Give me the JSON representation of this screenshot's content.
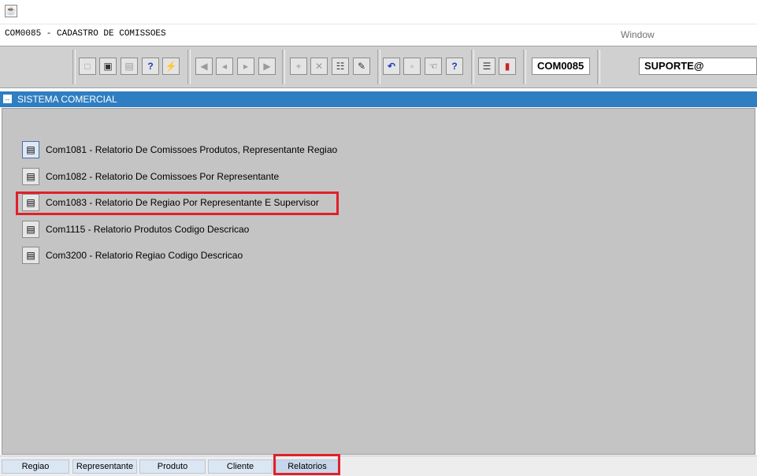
{
  "window": {
    "caption": "COM0085 - CADASTRO DE COMISSOES",
    "menu_window": "Window"
  },
  "toolbar": {
    "form_code": "COM0085",
    "user": "SUPORTE@"
  },
  "section": {
    "title": "SISTEMA COMERCIAL"
  },
  "reports": [
    {
      "label": "Com1081 - Relatorio De Comissoes Produtos, Representante Regiao"
    },
    {
      "label": "Com1082 - Relatorio De Comissoes Por Representante"
    },
    {
      "label": "Com1083 - Relatorio De Regiao Por Representante E Supervisor"
    },
    {
      "label": "Com1115 - Relatorio Produtos Codigo Descricao"
    },
    {
      "label": "Com3200 - Relatorio Regiao Codigo Descricao"
    }
  ],
  "tabs": [
    {
      "label": "Regiao"
    },
    {
      "label": "Representante"
    },
    {
      "label": "Produto"
    },
    {
      "label": "Cliente"
    },
    {
      "label": "Relatorios"
    }
  ],
  "active_tab": "Relatorios",
  "colors": {
    "header_blue": "#2f7ec2",
    "highlight_red": "#e0202a",
    "panel_gray": "#c4c4c4"
  }
}
